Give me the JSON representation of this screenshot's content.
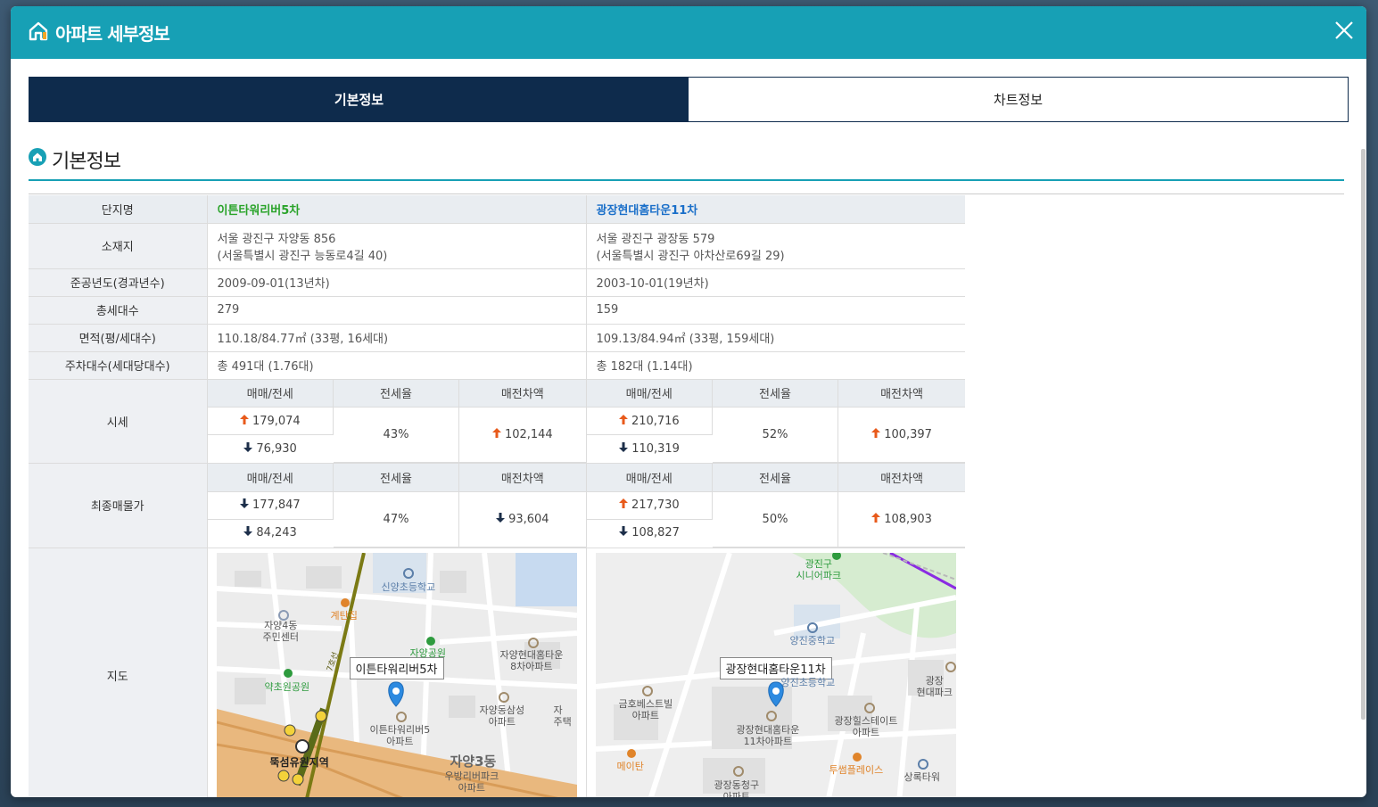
{
  "modal": {
    "title": "아파트 세부정보"
  },
  "tabs": [
    {
      "label": "기본정보",
      "active": true
    },
    {
      "label": "차트정보",
      "active": false
    }
  ],
  "section": {
    "title": "기본정보"
  },
  "rows": {
    "name": {
      "label": "단지명",
      "a": "이튼타워리버5차",
      "b": "광장현대홈타운11차"
    },
    "address": {
      "label": "소재지",
      "a_line1": "서울 광진구 자양동 856",
      "a_line2": "(서울특별시 광진구 능동로4길 40)",
      "b_line1": "서울 광진구 광장동 579",
      "b_line2": "(서울특별시 광진구 아차산로69길 29)"
    },
    "built": {
      "label": "준공년도(경과년수)",
      "a": "2009-09-01(13년차)",
      "b": "2003-10-01(19년차)"
    },
    "households": {
      "label": "총세대수",
      "a": "279",
      "b": "159"
    },
    "area": {
      "label": "면적(평/세대수)",
      "a": "110.18/84.77㎡ (33평, 16세대)",
      "b": "109.13/84.94㎡ (33평, 159세대)"
    },
    "parking": {
      "label": "주차대수(세대당대수)",
      "a": "총 491대 (1.76대)",
      "b": "총 182대 (1.14대)"
    }
  },
  "sub_headers": {
    "price": "매매/전세",
    "ratio": "전세율",
    "gap": "매전차액"
  },
  "market": {
    "label": "시세",
    "a": {
      "sale": "179,074",
      "sale_dir": "up",
      "jeonse": "76,930",
      "jeonse_dir": "down",
      "ratio": "43%",
      "gap": "102,144",
      "gap_dir": "up"
    },
    "b": {
      "sale": "210,716",
      "sale_dir": "up",
      "jeonse": "110,319",
      "jeonse_dir": "down",
      "ratio": "52%",
      "gap": "100,397",
      "gap_dir": "up"
    }
  },
  "listing": {
    "label": "최종매물가",
    "a": {
      "sale": "177,847",
      "sale_dir": "down",
      "jeonse": "84,243",
      "jeonse_dir": "down",
      "ratio": "47%",
      "gap": "93,604",
      "gap_dir": "down"
    },
    "b": {
      "sale": "217,730",
      "sale_dir": "up",
      "jeonse": "108,827",
      "jeonse_dir": "down",
      "ratio": "50%",
      "gap": "108,903",
      "gap_dir": "up"
    }
  },
  "map": {
    "label": "지도",
    "a": {
      "popup": "이튼타워리버5차",
      "labels": [
        "신양초등학교",
        "자양4동\n주민센터",
        "계탄집",
        "자양공원",
        "자양현대홈타운\n8차아파트",
        "약초원공원",
        "자양동삼성\n아파트",
        "자\n주택",
        "이튼타워리버5\n아파트",
        "뚝섬유원지역",
        "자양3동",
        "우방리버파크\n아파트",
        "7호선"
      ]
    },
    "b": {
      "popup": "광장현대홈타운11차",
      "labels": [
        "광진구\n시니어파크",
        "양진중학교",
        "양진초등학교",
        "광장\n현대파크",
        "금호베스트빌\n아파트",
        "광장힐스테이트\n아파트",
        "광장현대홈타운\n11차아파트",
        "메이탄",
        "투썸플레이스",
        "상록타워",
        "광장동청구\n아파트"
      ]
    }
  },
  "colors": {
    "header": "#17a0b5",
    "tab_active": "#0e2b4c",
    "up": "#e85a1b",
    "down": "#1d2f4a",
    "name_a": "#29a329",
    "name_b": "#1a6fc9"
  },
  "icons": {
    "title": "home-icon",
    "section": "home-circle-icon",
    "close": "close-icon",
    "up": "arrow-up-icon",
    "down": "arrow-down-icon",
    "pin": "map-pin-icon"
  }
}
